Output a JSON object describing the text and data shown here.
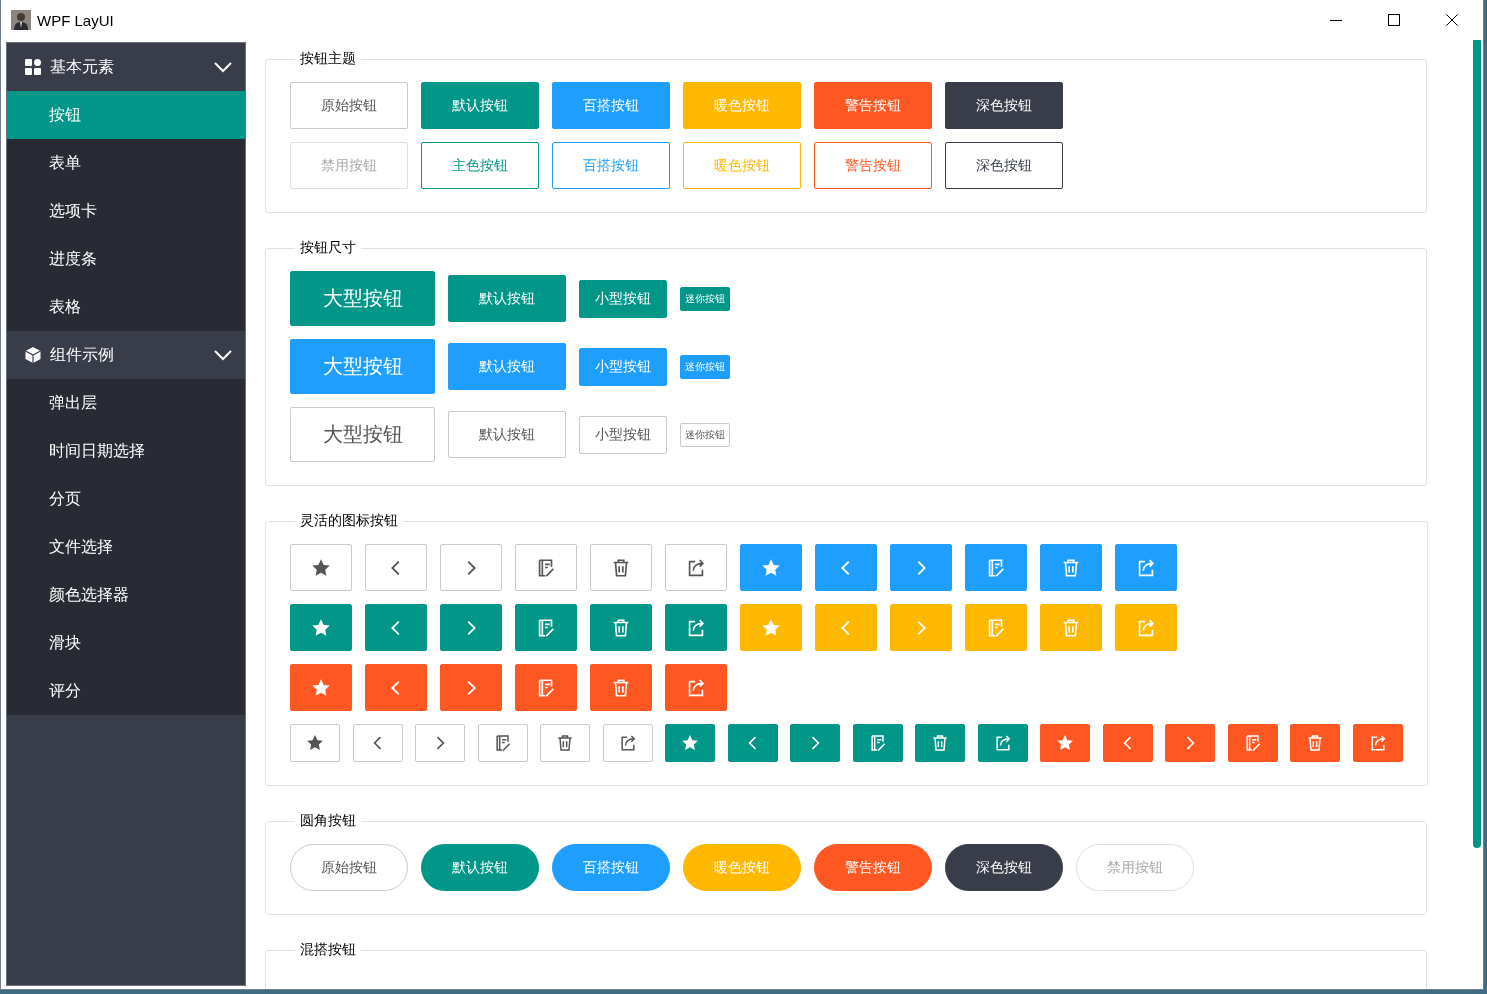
{
  "window": {
    "title": "WPF LayUI"
  },
  "sidebar": {
    "groups": [
      {
        "title": "基本元素",
        "expanded": true,
        "items": [
          {
            "label": "按钮",
            "selected": true
          },
          {
            "label": "表单",
            "selected": false
          },
          {
            "label": "选项卡",
            "selected": false
          },
          {
            "label": "进度条",
            "selected": false
          },
          {
            "label": "表格",
            "selected": false
          }
        ]
      },
      {
        "title": "组件示例",
        "expanded": true,
        "items": [
          {
            "label": "弹出层",
            "selected": false
          },
          {
            "label": "时间日期选择",
            "selected": false
          },
          {
            "label": "分页",
            "selected": false
          },
          {
            "label": "文件选择",
            "selected": false
          },
          {
            "label": "颜色选择器",
            "selected": false
          },
          {
            "label": "滑块",
            "selected": false
          },
          {
            "label": "评分",
            "selected": false
          }
        ]
      }
    ]
  },
  "sections": [
    {
      "title": "按钮主题",
      "rows": [
        {
          "kind": "normal",
          "buttons": [
            {
              "label": "原始按钮",
              "color": "#ffffff",
              "disabled": false
            },
            {
              "label": "默认按钮",
              "color": "#009688",
              "outline": false,
              "disabled": false
            },
            {
              "label": "百搭按钮",
              "color": "#1e9fff",
              "outline": false,
              "disabled": false
            },
            {
              "label": "暖色按钮",
              "color": "#ffb800",
              "outline": false,
              "disabled": false
            },
            {
              "label": "警告按钮",
              "color": "#ff5722",
              "outline": false,
              "disabled": false
            },
            {
              "label": "深色按钮",
              "color": "#393d49",
              "outline": false,
              "disabled": false
            }
          ]
        },
        {
          "kind": "normal",
          "buttons": [
            {
              "label": "禁用按钮",
              "color": "#ffffff",
              "disabled": true
            },
            {
              "label": "主色按钮",
              "color": "#009688",
              "outline": true,
              "disabled": false
            },
            {
              "label": "百搭按钮",
              "color": "#1e9fff",
              "outline": true,
              "disabled": false
            },
            {
              "label": "暖色按钮",
              "color": "#ffb800",
              "outline": true,
              "disabled": false
            },
            {
              "label": "警告按钮",
              "color": "#ff5722",
              "outline": true,
              "disabled": false
            },
            {
              "label": "深色按钮",
              "color": "#393d49",
              "outline": true,
              "disabled": false
            }
          ]
        }
      ]
    },
    {
      "title": "按钮尺寸",
      "rows": [
        {
          "kind": "sizes",
          "buttons": [
            {
              "label": "大型按钮",
              "color": "#009688"
            },
            {
              "label": "默认按钮",
              "color": "#009688"
            },
            {
              "label": "小型按钮",
              "color": "#009688"
            },
            {
              "label": "迷你按钮",
              "color": "#009688"
            }
          ]
        },
        {
          "kind": "sizes",
          "buttons": [
            {
              "label": "大型按钮",
              "color": "#1e9fff"
            },
            {
              "label": "默认按钮",
              "color": "#1e9fff"
            },
            {
              "label": "小型按钮",
              "color": "#1e9fff"
            },
            {
              "label": "迷你按钮",
              "color": "#1e9fff"
            }
          ]
        },
        {
          "kind": "sizes",
          "buttons": [
            {
              "label": "大型按钮",
              "color": "#ffffff"
            },
            {
              "label": "默认按钮",
              "color": "#ffffff"
            },
            {
              "label": "小型按钮",
              "color": "#ffffff"
            },
            {
              "label": "迷你按钮",
              "color": "#ffffff"
            }
          ]
        }
      ]
    },
    {
      "title": "灵活的图标按钮",
      "rows": [
        {
          "kind": "normal",
          "buttons": [
            {
              "kind": "star",
              "color": "#ffffff"
            },
            {
              "kind": "left",
              "color": "#ffffff"
            },
            {
              "kind": "right",
              "color": "#ffffff"
            },
            {
              "kind": "note",
              "color": "#ffffff"
            },
            {
              "kind": "trash",
              "color": "#ffffff"
            },
            {
              "kind": "share",
              "color": "#ffffff"
            },
            {
              "kind": "star",
              "color": "#1e9fff"
            },
            {
              "kind": "left",
              "color": "#1e9fff"
            },
            {
              "kind": "right",
              "color": "#1e9fff"
            },
            {
              "kind": "note",
              "color": "#1e9fff"
            },
            {
              "kind": "trash",
              "color": "#1e9fff"
            },
            {
              "kind": "share",
              "color": "#1e9fff"
            }
          ]
        },
        {
          "kind": "normal",
          "buttons": [
            {
              "kind": "star",
              "color": "#009688"
            },
            {
              "kind": "left",
              "color": "#009688"
            },
            {
              "kind": "right",
              "color": "#009688"
            },
            {
              "kind": "note",
              "color": "#009688"
            },
            {
              "kind": "trash",
              "color": "#009688"
            },
            {
              "kind": "share",
              "color": "#009688"
            },
            {
              "kind": "star",
              "color": "#ffb800"
            },
            {
              "kind": "left",
              "color": "#ffb800"
            },
            {
              "kind": "right",
              "color": "#ffb800"
            },
            {
              "kind": "note",
              "color": "#ffb800"
            },
            {
              "kind": "trash",
              "color": "#ffb800"
            },
            {
              "kind": "share",
              "color": "#ffb800"
            }
          ]
        },
        {
          "kind": "normal",
          "buttons": [
            {
              "kind": "star",
              "color": "#ff5722"
            },
            {
              "kind": "left",
              "color": "#ff5722"
            },
            {
              "kind": "right",
              "color": "#ff5722"
            },
            {
              "kind": "note",
              "color": "#ff5722"
            },
            {
              "kind": "trash",
              "color": "#ff5722"
            },
            {
              "kind": "share",
              "color": "#ff5722"
            }
          ]
        },
        {
          "kind": "small",
          "buttons": [
            {
              "kind": "star",
              "color": "#ffffff"
            },
            {
              "kind": "left",
              "color": "#ffffff"
            },
            {
              "kind": "right",
              "color": "#ffffff"
            },
            {
              "kind": "note",
              "color": "#ffffff"
            },
            {
              "kind": "trash",
              "color": "#ffffff"
            },
            {
              "kind": "share",
              "color": "#ffffff"
            },
            {
              "kind": "star",
              "color": "#009688"
            },
            {
              "kind": "left",
              "color": "#009688"
            },
            {
              "kind": "right",
              "color": "#009688"
            },
            {
              "kind": "note",
              "color": "#009688"
            },
            {
              "kind": "trash",
              "color": "#009688"
            },
            {
              "kind": "share",
              "color": "#009688"
            },
            {
              "kind": "star",
              "color": "#ff5722"
            },
            {
              "kind": "left",
              "color": "#ff5722"
            },
            {
              "kind": "right",
              "color": "#ff5722"
            },
            {
              "kind": "note",
              "color": "#ff5722"
            },
            {
              "kind": "trash",
              "color": "#ff5722"
            },
            {
              "kind": "share",
              "color": "#ff5722"
            }
          ]
        }
      ]
    },
    {
      "title": "圆角按钮",
      "rows": [
        {
          "kind": "normal",
          "buttons": [
            {
              "label": "原始按钮",
              "color": "#ffffff",
              "round": true,
              "disabled": false
            },
            {
              "label": "默认按钮",
              "color": "#009688",
              "round": true,
              "disabled": false
            },
            {
              "label": "百搭按钮",
              "color": "#1e9fff",
              "round": true,
              "disabled": false
            },
            {
              "label": "暖色按钮",
              "color": "#ffb800",
              "round": true,
              "disabled": false
            },
            {
              "label": "警告按钮",
              "color": "#ff5722",
              "round": true,
              "disabled": false
            },
            {
              "label": "深色按钮",
              "color": "#393d49",
              "round": true,
              "disabled": false
            },
            {
              "label": "禁用按钮",
              "color": "#ffffff",
              "round": true,
              "disabled": true
            }
          ]
        }
      ]
    },
    {
      "title": "混搭按钮"
    }
  ]
}
